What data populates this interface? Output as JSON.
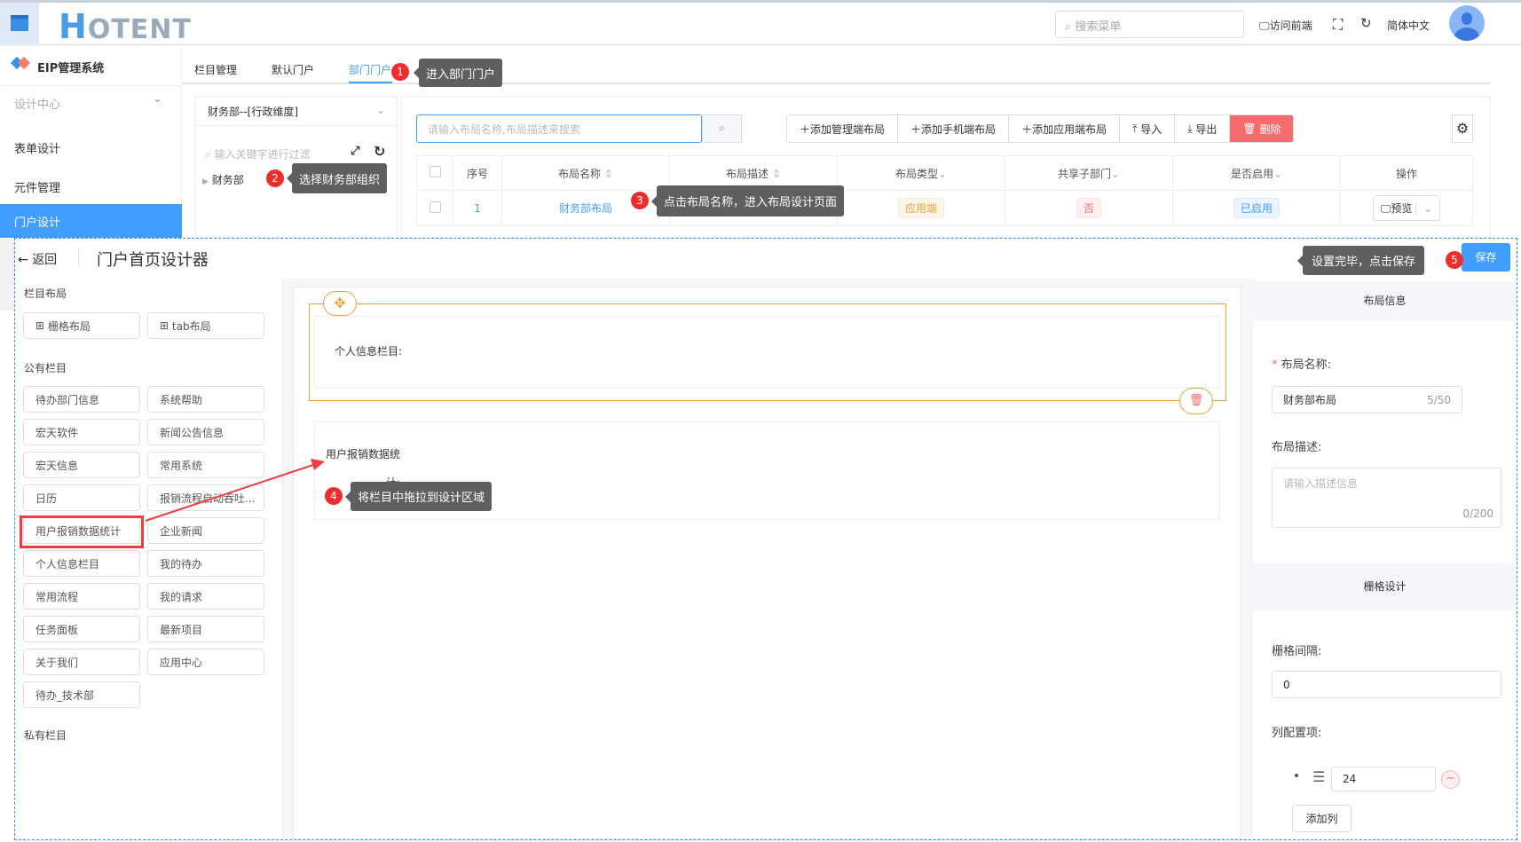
{
  "header": {
    "logo": "HOTENT",
    "search_placeholder": "搜索菜单",
    "visit_front": "访问前端",
    "language": "简体中文"
  },
  "sidebar": {
    "system": "EIP管理系统",
    "group": "设计中心",
    "items": [
      {
        "label": "表单设计"
      },
      {
        "label": "元件管理"
      },
      {
        "label": "门户设计",
        "active": true
      }
    ]
  },
  "tabs": [
    {
      "label": "栏目管理"
    },
    {
      "label": "默认门户"
    },
    {
      "label": "部门门户",
      "active": true
    }
  ],
  "tree": {
    "dimension": "财务部--[行政维度]",
    "filter_placeholder": "输入关键字进行过滤",
    "node": "财务部"
  },
  "toolbar": {
    "search_placeholder": "请输入布局名称,布局描述来搜索",
    "add_admin": "添加管理端布局",
    "add_mobile": "添加手机端布局",
    "add_app": "添加应用端布局",
    "import": "导入",
    "export": "导出",
    "delete": "删除"
  },
  "table": {
    "columns": [
      "序号",
      "布局名称",
      "布局描述",
      "布局类型",
      "共享子部门",
      "是否启用",
      "操作"
    ],
    "rows": [
      {
        "index": "1",
        "name": "财务部布局",
        "desc": "",
        "type": "应用端",
        "share": "否",
        "enabled": "已启用",
        "action": "预览"
      }
    ]
  },
  "designer": {
    "back": "返回",
    "title": "门户首页设计器",
    "save": "保存",
    "palette": {
      "layout_title": "栏目布局",
      "layouts": [
        "栅格布局",
        "tab布局"
      ],
      "public_title": "公有栏目",
      "public_items": [
        "待办部门信息",
        "系统帮助",
        "宏天软件",
        "新闻公告信息",
        "宏天信息",
        "常用系统",
        "日历",
        "报销流程启动吞吐...",
        "用户报销数据统计",
        "企业新闻",
        "个人信息栏目",
        "我的待办",
        "常用流程",
        "我的请求",
        "任务面板",
        "最新项目",
        "关于我们",
        "应用中心",
        "待办_技术部"
      ],
      "private_title": "私有栏目"
    },
    "canvas": {
      "block1": "个人信息栏目:",
      "block2_line1": "用户报销数据统",
      "block2_line2": "计:"
    },
    "props": {
      "info_title": "布局信息",
      "name_label": "布局名称:",
      "name_value": "财务部布局",
      "name_count": "5/50",
      "desc_label": "布局描述:",
      "desc_placeholder": "请输入描述信息",
      "desc_count": "0/200",
      "grid_title": "栅格设计",
      "gap_label": "栅格间隔:",
      "gap_value": "0",
      "cols_label": "列配置项:",
      "col_value": "24",
      "add_col": "添加列"
    }
  },
  "annotations": [
    {
      "n": "1",
      "text": "进入部门门户"
    },
    {
      "n": "2",
      "text": "选择财务部组织"
    },
    {
      "n": "3",
      "text": "点击布局名称，进入布局设计页面"
    },
    {
      "n": "4",
      "text": "将栏目中拖拉到设计区域"
    },
    {
      "n": "5",
      "text": "设置完毕，点击保存"
    }
  ],
  "colors": {
    "primary": "#409eff",
    "danger": "#f56c6c",
    "annotation_red": "#f02d2d",
    "highlight_orange": "#e6a23c"
  }
}
